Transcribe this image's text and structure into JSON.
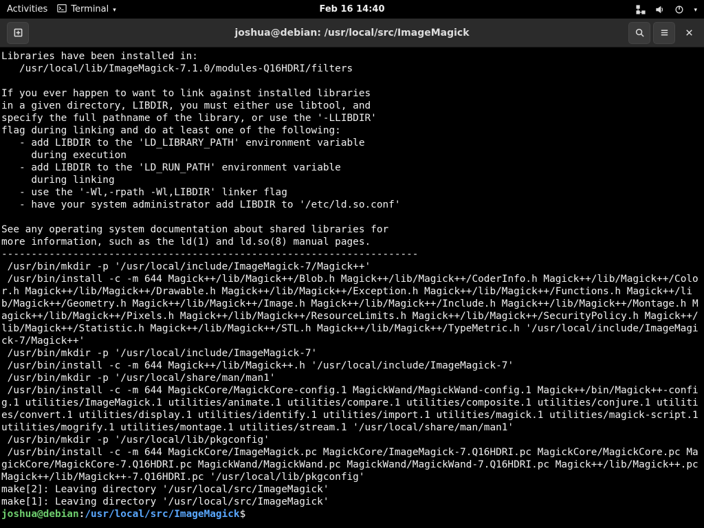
{
  "topbar": {
    "activities": "Activities",
    "app_label": "Terminal",
    "clock": "Feb 16  14:40"
  },
  "window": {
    "title": "joshua@debian: /usr/local/src/ImageMagick"
  },
  "prompt": {
    "user": "joshua",
    "at": "@",
    "host": "debian",
    "sep": ":",
    "path": "/usr/local/src/ImageMagick",
    "suffix": "$ "
  },
  "terminal_lines": [
    "Libraries have been installed in:",
    "   /usr/local/lib/ImageMagick-7.1.0/modules-Q16HDRI/filters",
    "",
    "If you ever happen to want to link against installed libraries",
    "in a given directory, LIBDIR, you must either use libtool, and",
    "specify the full pathname of the library, or use the '-LLIBDIR'",
    "flag during linking and do at least one of the following:",
    "   - add LIBDIR to the 'LD_LIBRARY_PATH' environment variable",
    "     during execution",
    "   - add LIBDIR to the 'LD_RUN_PATH' environment variable",
    "     during linking",
    "   - use the '-Wl,-rpath -Wl,LIBDIR' linker flag",
    "   - have your system administrator add LIBDIR to '/etc/ld.so.conf'",
    "",
    "See any operating system documentation about shared libraries for",
    "more information, such as the ld(1) and ld.so(8) manual pages.",
    "----------------------------------------------------------------------",
    " /usr/bin/mkdir -p '/usr/local/include/ImageMagick-7/Magick++'",
    " /usr/bin/install -c -m 644 Magick++/lib/Magick++/Blob.h Magick++/lib/Magick++/CoderInfo.h Magick++/lib/Magick++/Color.h Magick++/lib/Magick++/Drawable.h Magick++/lib/Magick++/Exception.h Magick++/lib/Magick++/Functions.h Magick++/lib/Magick++/Geometry.h Magick++/lib/Magick++/Image.h Magick++/lib/Magick++/Include.h Magick++/lib/Magick++/Montage.h Magick++/lib/Magick++/Pixels.h Magick++/lib/Magick++/ResourceLimits.h Magick++/lib/Magick++/SecurityPolicy.h Magick++/lib/Magick++/Statistic.h Magick++/lib/Magick++/STL.h Magick++/lib/Magick++/TypeMetric.h '/usr/local/include/ImageMagick-7/Magick++'",
    " /usr/bin/mkdir -p '/usr/local/include/ImageMagick-7'",
    " /usr/bin/install -c -m 644 Magick++/lib/Magick++.h '/usr/local/include/ImageMagick-7'",
    " /usr/bin/mkdir -p '/usr/local/share/man/man1'",
    " /usr/bin/install -c -m 644 MagickCore/MagickCore-config.1 MagickWand/MagickWand-config.1 Magick++/bin/Magick++-config.1 utilities/ImageMagick.1 utilities/animate.1 utilities/compare.1 utilities/composite.1 utilities/conjure.1 utilities/convert.1 utilities/display.1 utilities/identify.1 utilities/import.1 utilities/magick.1 utilities/magick-script.1 utilities/mogrify.1 utilities/montage.1 utilities/stream.1 '/usr/local/share/man/man1'",
    " /usr/bin/mkdir -p '/usr/local/lib/pkgconfig'",
    " /usr/bin/install -c -m 644 MagickCore/ImageMagick.pc MagickCore/ImageMagick-7.Q16HDRI.pc MagickCore/MagickCore.pc MagickCore/MagickCore-7.Q16HDRI.pc MagickWand/MagickWand.pc MagickWand/MagickWand-7.Q16HDRI.pc Magick++/lib/Magick++.pc Magick++/lib/Magick++-7.Q16HDRI.pc '/usr/local/lib/pkgconfig'",
    "make[2]: Leaving directory '/usr/local/src/ImageMagick'",
    "make[1]: Leaving directory '/usr/local/src/ImageMagick'"
  ]
}
